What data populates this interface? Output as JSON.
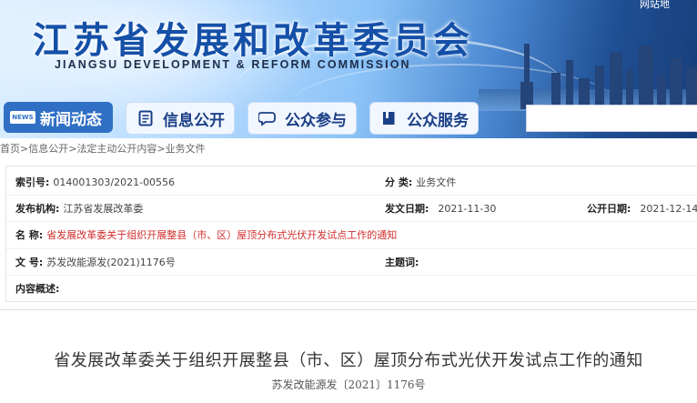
{
  "header": {
    "title_cn": "江苏省发展和改革委员会",
    "title_en": "JIANGSU DEVELOPMENT & REFORM COMMISSION",
    "top_link": "网站地"
  },
  "nav": {
    "items": [
      {
        "label": "新闻动态",
        "icon": "news-icon",
        "active": true
      },
      {
        "label": "信息公开",
        "icon": "document-icon",
        "active": false
      },
      {
        "label": "公众参与",
        "icon": "chat-bubble-icon",
        "active": false
      },
      {
        "label": "公众服务",
        "icon": "book-icon",
        "active": false
      }
    ],
    "news_badge": "NEWS"
  },
  "breadcrumb": {
    "items": [
      "首页",
      "信息公开",
      "法定主动公开内容",
      "业务文件"
    ],
    "separator": ">"
  },
  "info": {
    "index_label": "索引号:",
    "index_value": "014001303/2021-00556",
    "category_label": "分  类:",
    "category_value": "业务文件",
    "publisher_label": "发布机构:",
    "publisher_value": "江苏省发展改革委",
    "issue_date_label": "发文日期:",
    "issue_date_value": "2021-11-30",
    "public_date_label": "公开日期:",
    "public_date_value": "2021-12-14",
    "name_label": "名  称:",
    "name_value": "省发展改革委关于组织开展整县（市、区）屋顶分布式光伏开发试点工作的通知",
    "doc_no_label": "文  号:",
    "doc_no_value": "苏发改能源发(2021)1176号",
    "subject_label": "主题词:",
    "subject_value": "",
    "summary_label": "内容概述:",
    "summary_value": ""
  },
  "article": {
    "title": "省发展改革委关于组织开展整县（市、区）屋顶分布式光伏开发试点工作的通知",
    "doc_no": "苏发改能源发〔2021〕1176号"
  },
  "colors": {
    "brand_blue": "#1550a8",
    "nav_active": "#2f6fc4",
    "highlight_red": "#d22d2d"
  }
}
